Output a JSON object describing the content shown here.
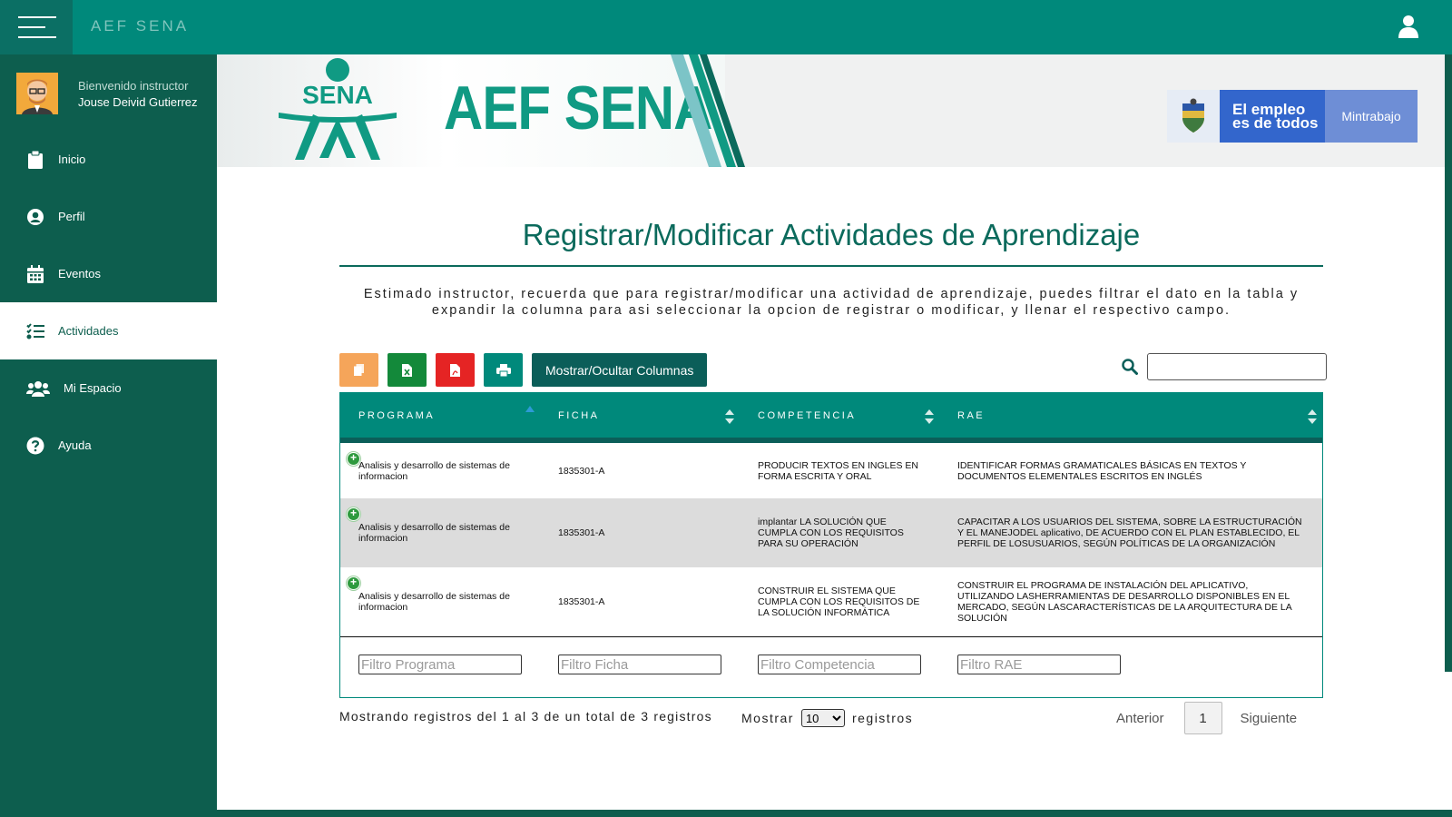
{
  "topbar": {
    "app_title": "AEF SENA"
  },
  "sidebar": {
    "welcome": "Bienvenido instructor",
    "username": "Jouse Deivid Gutierrez",
    "items": [
      {
        "label": "Inicio",
        "icon": "clipboard-icon",
        "active": false
      },
      {
        "label": "Perfil",
        "icon": "user-circle-icon",
        "active": false
      },
      {
        "label": "Eventos",
        "icon": "calendar-icon",
        "active": false
      },
      {
        "label": "Actividades",
        "icon": "list-check-icon",
        "active": true
      },
      {
        "label": "Mi Espacio",
        "icon": "users-icon",
        "active": false
      },
      {
        "label": "Ayuda",
        "icon": "question-icon",
        "active": false
      }
    ]
  },
  "banner": {
    "logo_text": "SENA",
    "brand_text": "AEF SENA",
    "gov_line1": "El empleo",
    "gov_line2": "es de todos",
    "gov_ministry": "Mintrabajo"
  },
  "main": {
    "title": "Registrar/Modificar Actividades de Aprendizaje",
    "intro": "Estimado instructor, recuerda que para registrar/modificar una actividad de aprendizaje, puedes filtrar el dato en la tabla y expandir la columna para asi seleccionar la opcion de registrar o modificar, y llenar el respectivo campo.",
    "toolbar": {
      "copy_icon": "copy-icon",
      "excel_icon": "file-excel-icon",
      "pdf_icon": "file-pdf-icon",
      "print_icon": "print-icon",
      "columns_label": "Mostrar/Ocultar Columnas"
    },
    "search": {
      "value": "",
      "icon": "search-icon"
    }
  },
  "table": {
    "columns": [
      "PROGRAMA",
      "FICHA",
      "COMPETENCIA",
      "RAE"
    ],
    "rows": [
      {
        "programa": "Analisis y desarrollo de sistemas de informacion",
        "ficha": "1835301-A",
        "competencia": "PRODUCIR TEXTOS EN INGLES EN FORMA ESCRITA Y ORAL",
        "rae": "IDENTIFICAR FORMAS GRAMATICALES BÁSICAS EN TEXTOS Y DOCUMENTOS ELEMENTALES ESCRITOS EN INGLÉS"
      },
      {
        "programa": "Analisis y desarrollo de sistemas de informacion",
        "ficha": "1835301-A",
        "competencia": "implantar LA SOLUCIÓN QUE CUMPLA CON LOS REQUISITOS PARA SU OPERACIÓN",
        "rae": "CAPACITAR A LOS USUARIOS DEL SISTEMA, SOBRE LA ESTRUCTURACIÓN Y EL MANEJODEL aplicativo, DE ACUERDO CON EL PLAN ESTABLECIDO, EL PERFIL DE LOSUSUARIOS, SEGÚN POLÍTICAS DE LA ORGANIZACIÓN"
      },
      {
        "programa": "Analisis y desarrollo de sistemas de informacion",
        "ficha": "1835301-A",
        "competencia": "CONSTRUIR EL SISTEMA QUE CUMPLA CON LOS REQUISITOS DE LA SOLUCIÓN INFORMÁTICA",
        "rae": "CONSTRUIR EL PROGRAMA DE INSTALACIÓN DEL APLICATIVO, UTILIZANDO LASHERRAMIENTAS DE DESARROLLO DISPONIBLES EN EL MERCADO, SEGÚN LASCARACTERÍSTICAS DE LA ARQUITECTURA DE LA SOLUCIÓN"
      }
    ],
    "filters": [
      "Filtro Programa",
      "Filtro Ficha",
      "Filtro Competencia",
      "Filtro RAE"
    ]
  },
  "footer": {
    "info": "Mostrando registros del 1 al 3 de un total de 3 registros",
    "show_label": "Mostrar",
    "show_value": "10",
    "records_label": "registros",
    "prev": "Anterior",
    "page": "1",
    "next": "Siguiente"
  },
  "colors": {
    "topbar": "#00897b",
    "sidebar": "#0d5e4e",
    "brand": "#109a83",
    "title": "#0b6a5c"
  }
}
